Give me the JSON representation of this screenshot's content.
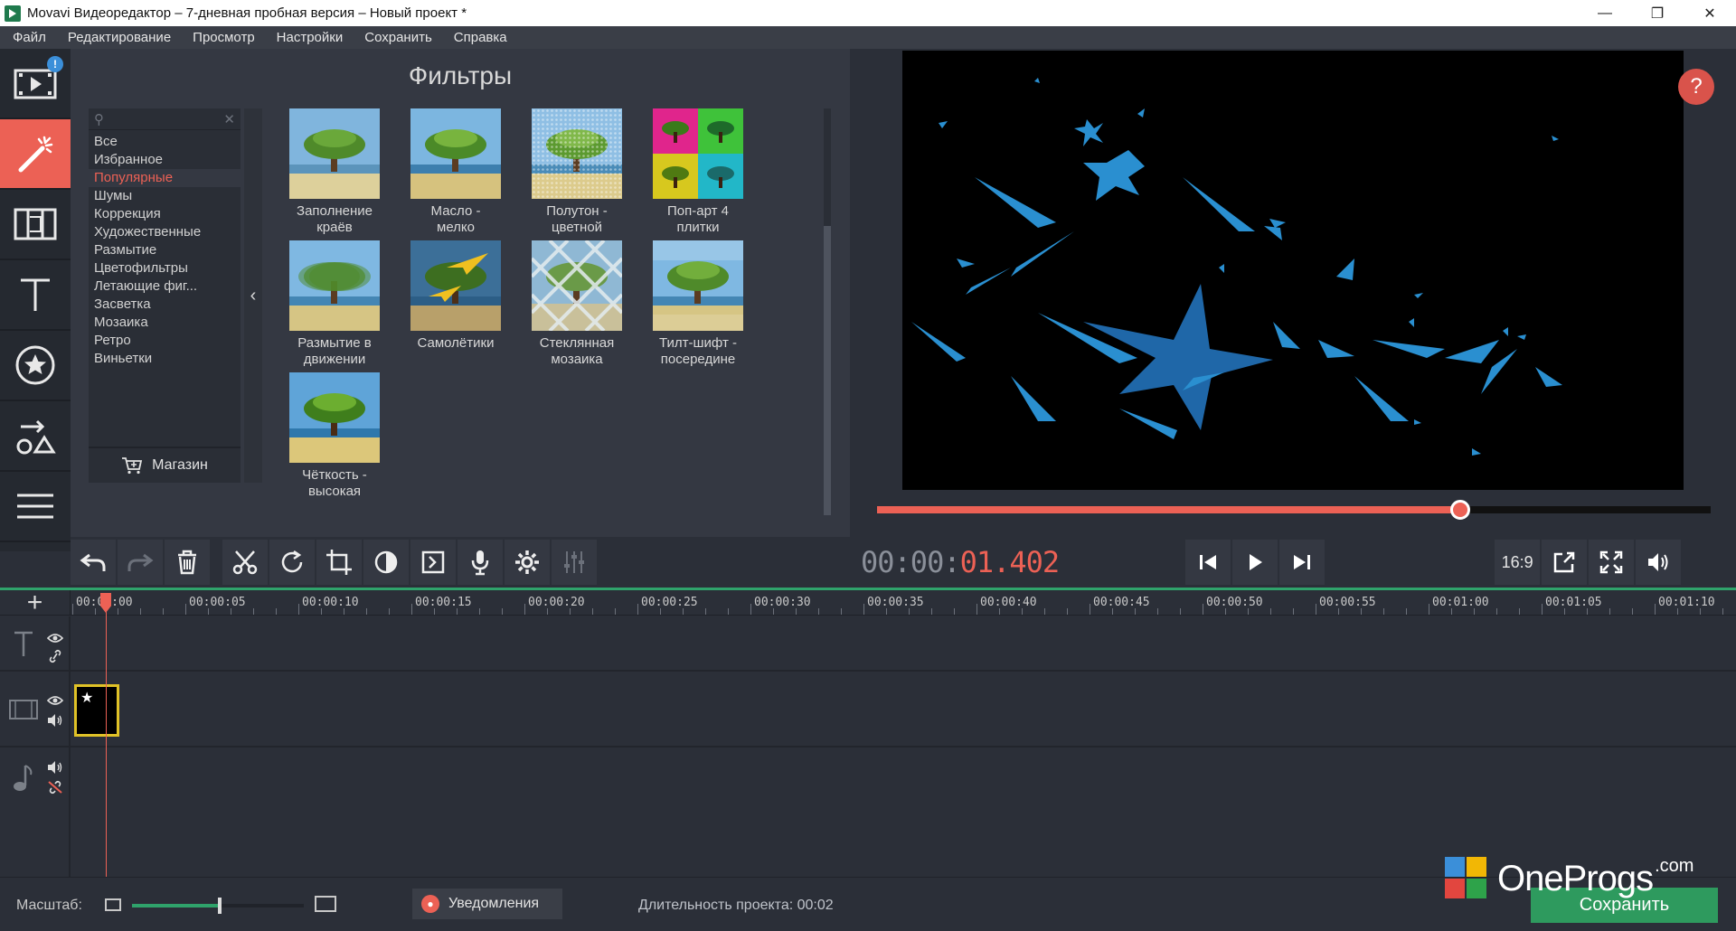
{
  "window": {
    "title": "Movavi Видеоредактор – 7-дневная пробная версия – Новый проект *",
    "minimize": "—",
    "restore": "❐",
    "close": "✕"
  },
  "menu": [
    "Файл",
    "Редактирование",
    "Просмотр",
    "Настройки",
    "Сохранить",
    "Справка"
  ],
  "toolrail": {
    "badge": "!",
    "tools": [
      "import-media-icon",
      "filters-wand-icon",
      "transitions-icon",
      "titles-icon",
      "stickers-icon",
      "callouts-shapes-icon",
      "more-tools-icon"
    ]
  },
  "filters": {
    "title": "Фильтры",
    "search_placeholder": "",
    "categories": [
      "Все",
      "Избранное",
      "Популярные",
      "Шумы",
      "Коррекция",
      "Художественные",
      "Размытие",
      "Цветофильтры",
      "Летающие фиг...",
      "Засветка",
      "Мозаика",
      "Ретро",
      "Виньетки"
    ],
    "active_category": "Популярные",
    "shop": "Магазин",
    "collapse": "‹",
    "items": [
      {
        "caption1": "Заполнение",
        "caption2": "краёв"
      },
      {
        "caption1": "Масло -",
        "caption2": "мелко"
      },
      {
        "caption1": "Полутон -",
        "caption2": "цветной"
      },
      {
        "caption1": "Поп-арт 4",
        "caption2": "плитки"
      },
      {
        "caption1": "Размытие в",
        "caption2": "движении"
      },
      {
        "caption1": "Самолётики",
        "caption2": ""
      },
      {
        "caption1": "Стеклянная",
        "caption2": "мозаика"
      },
      {
        "caption1": "Тилт-шифт -",
        "caption2": "посередине"
      },
      {
        "caption1": "Чёткость -",
        "caption2": "высокая"
      }
    ]
  },
  "preview": {
    "help": "?",
    "progress": 0.7
  },
  "player": {
    "timecode_dim": "00:00:",
    "timecode_live": "01.402",
    "ratio": "16:9"
  },
  "timeline": {
    "add": "+",
    "ticks": [
      "00:00:00",
      "00:00:05",
      "00:00:10",
      "00:00:15",
      "00:00:20",
      "00:00:25",
      "00:00:30",
      "00:00:35",
      "00:00:40",
      "00:00:45",
      "00:00:50",
      "00:00:55",
      "00:01:00",
      "00:01:05",
      "00:01:10"
    ],
    "clip_icon": "★"
  },
  "status": {
    "zoom_label": "Масштаб:",
    "zoom_level": 0.5,
    "notifications": "Уведомления",
    "duration": "Длительность проекта:  00:02",
    "save": "Сохранить"
  },
  "watermark": {
    "text": "OneProgs",
    "suffix": ".com"
  },
  "colors": {
    "accent": "#ec6155",
    "green": "#2e9a5e",
    "panel": "#343842",
    "star_blue": "#2a8fd0"
  }
}
